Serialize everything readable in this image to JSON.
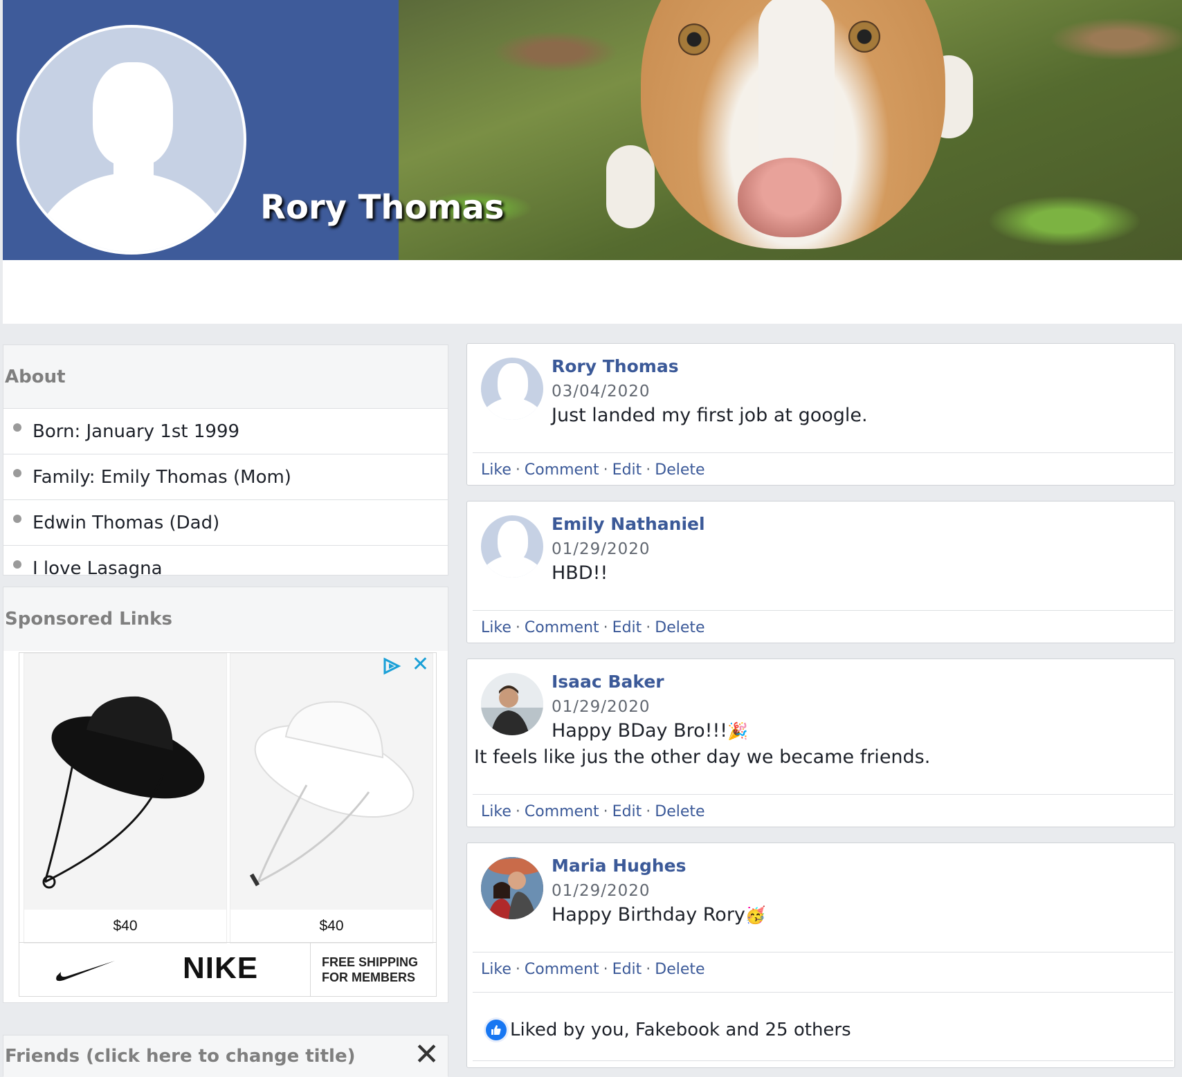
{
  "profile": {
    "name": "Rory Thomas"
  },
  "about": {
    "title": "About",
    "items": [
      "Born: January 1st 1999",
      "Family: Emily Thomas (Mom)",
      "Edwin Thomas (Dad)",
      "I love Lasagna"
    ]
  },
  "sponsored": {
    "title": "Sponsored Links",
    "ad": {
      "products": [
        {
          "name": "black-bucket-hat",
          "price": "$40"
        },
        {
          "name": "white-bucket-hat",
          "price": "$40"
        }
      ],
      "brand": "NIKE",
      "shipping_line1": "FREE SHIPPING",
      "shipping_line2": "FOR MEMBERS",
      "close": "✕"
    }
  },
  "friends": {
    "title": "Friends (click here to change title)",
    "close": "✕"
  },
  "posts": [
    {
      "author": "Rory Thomas",
      "date": "03/04/2020",
      "text": "Just landed my first job at google.",
      "text2": ""
    },
    {
      "author": "Emily Nathaniel",
      "date": "01/29/2020",
      "text": "HBD!!",
      "text2": ""
    },
    {
      "author": "Isaac Baker",
      "date": "01/29/2020",
      "text": "Happy BDay Bro!!!",
      "emoji": "🎉",
      "text2": "It feels like jus the other day we became friends."
    },
    {
      "author": "Maria Hughes",
      "date": "01/29/2020",
      "text": "Happy Birthday Rory",
      "emoji": "🥳",
      "text2": "",
      "likes": "Liked by you, Fakebook and 25 others"
    }
  ],
  "actions": {
    "like": "Like",
    "comment": "Comment",
    "edit": "Edit",
    "delete": "Delete",
    "sep": "·"
  },
  "colors": {
    "brand_blue": "#3e5b9a",
    "link_blue": "#3b5998",
    "page_bg": "#e9ebee"
  }
}
